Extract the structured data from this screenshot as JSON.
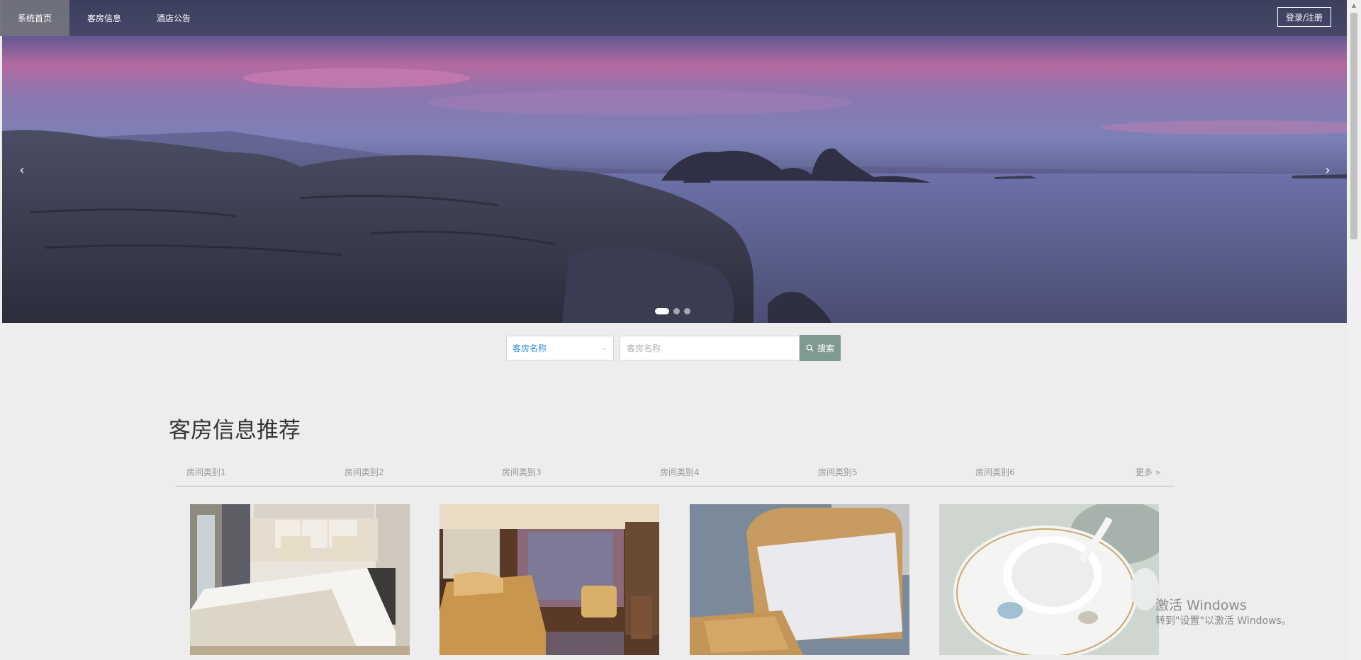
{
  "nav": {
    "items": [
      {
        "label": "系统首页",
        "active": true
      },
      {
        "label": "客房信息",
        "active": false
      },
      {
        "label": "酒店公告",
        "active": false
      }
    ],
    "login_label": "登录/注册"
  },
  "banner": {
    "prev_glyph": "‹",
    "next_glyph": "›",
    "slide_count": 3,
    "active_slide": 1
  },
  "search": {
    "field_option": "客房名称",
    "placeholder": "客房名称",
    "button_label": "搜索",
    "button_icon": "search-icon"
  },
  "section": {
    "title": "客房信息推荐",
    "categories": [
      "房间类别1",
      "房间类别2",
      "房间类别3",
      "房间类别4",
      "房间类别5",
      "房间类别6"
    ],
    "more_label": "更多",
    "more_icon": "double-chevron-right-icon"
  },
  "cards": [
    {
      "image": "white-bedroom-photo"
    },
    {
      "image": "hotel-suite-photo"
    },
    {
      "image": "wooden-bed-mattress-photo"
    },
    {
      "image": "porcelain-tableware-photo"
    }
  ],
  "watermark": {
    "line1": "激活 Windows",
    "line2": "转到\"设置\"以激活 Windows。"
  },
  "colors": {
    "nav_bg": "#3c405c",
    "search_button": "#7f9a90",
    "select_text": "#3b8fd6",
    "page_bg": "#ededed"
  }
}
